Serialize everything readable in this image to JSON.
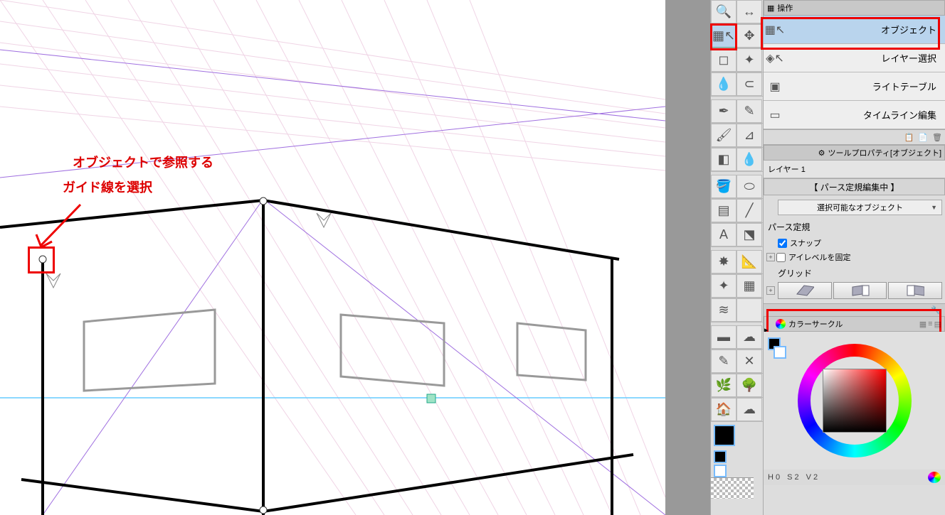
{
  "annotation": {
    "line1": "オブジェクトで参照する",
    "line2": "ガイド線を選択"
  },
  "operation_panel": {
    "title": "操作",
    "subtools": [
      {
        "label": "オブジェクト",
        "icon": "cube-arrow-icon",
        "selected": true
      },
      {
        "label": "レイヤー選択",
        "icon": "layer-arrow-icon",
        "selected": false
      },
      {
        "label": "ライトテーブル",
        "icon": "light-table-icon",
        "selected": false
      },
      {
        "label": "タイムライン編集",
        "icon": "timeline-icon",
        "selected": false
      }
    ]
  },
  "tool_property": {
    "title": "ツールプロパティ[オブジェクト]",
    "layer_name": "レイヤー 1",
    "editing_status": "【 パース定規編集中 】",
    "dropdown_label": "選択可能なオブジェクト",
    "ruler_section": "パース定規",
    "snap_label": "スナップ",
    "snap_checked": true,
    "eyelevel_label": "アイレベルを固定",
    "eyelevel_checked": false,
    "grid_label": "グリッド"
  },
  "color_panel": {
    "title": "カラーサークル",
    "readout": {
      "h": "H 0",
      "s": "S 2",
      "v": "V 2"
    }
  },
  "colors": {
    "highlight": "#e00000",
    "selected_bg": "#b9d4ed"
  }
}
